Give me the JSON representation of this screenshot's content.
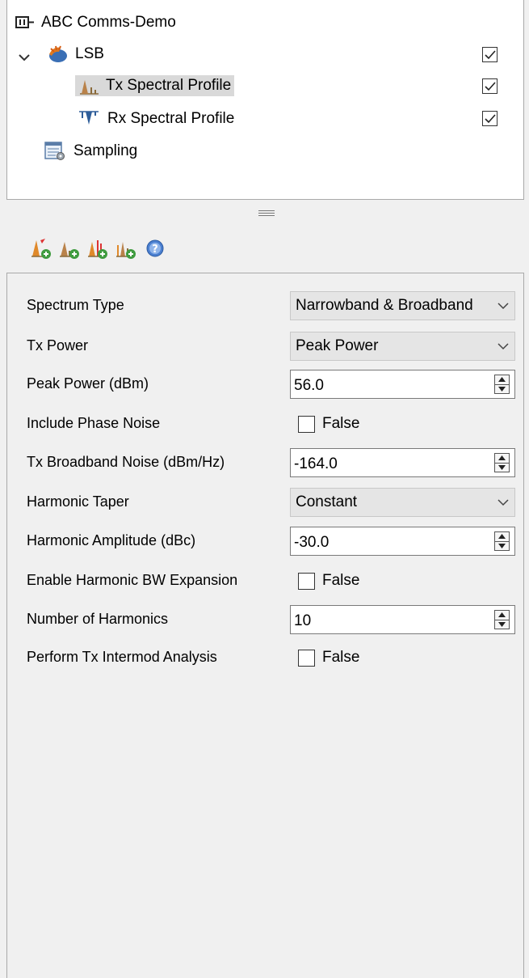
{
  "tree": {
    "root": {
      "label": "ABC Comms-Demo",
      "icon": "project-icon"
    },
    "items": [
      {
        "label": "LSB",
        "icon": "lsb-icon",
        "checked": true
      },
      {
        "label": "Tx Spectral Profile",
        "icon": "tx-spectrum-icon",
        "checked": true,
        "selected": true
      },
      {
        "label": "Rx Spectral Profile",
        "icon": "rx-spectrum-icon",
        "checked": true
      },
      {
        "label": "Sampling",
        "icon": "sampling-icon"
      }
    ]
  },
  "toolbar": {
    "buttons": [
      {
        "icon": "add-tx-profile-icon"
      },
      {
        "icon": "add-spectrum-icon"
      },
      {
        "icon": "add-harmonics-icon"
      },
      {
        "icon": "add-rx-profile-icon"
      },
      {
        "icon": "help-icon"
      }
    ]
  },
  "properties": {
    "spectrum_type": {
      "label": "Spectrum Type",
      "value": "Narrowband & Broadband"
    },
    "tx_power": {
      "label": "Tx Power",
      "value": "Peak Power"
    },
    "peak_power": {
      "label": "Peak Power (dBm)",
      "value": "56.0"
    },
    "include_phase_noise": {
      "label": "Include Phase Noise",
      "value": "False"
    },
    "tx_broadband_noise": {
      "label": "Tx Broadband Noise (dBm/Hz)",
      "value": "-164.0"
    },
    "harmonic_taper": {
      "label": "Harmonic Taper",
      "value": "Constant"
    },
    "harmonic_amplitude": {
      "label": "Harmonic Amplitude (dBc)",
      "value": "-30.0"
    },
    "enable_harmonic_bw": {
      "label": "Enable Harmonic BW Expansion",
      "value": "False"
    },
    "number_of_harmonics": {
      "label": "Number of Harmonics",
      "value": "10"
    },
    "perform_tx_intermod": {
      "label": "Perform Tx Intermod Analysis",
      "value": "False"
    }
  }
}
